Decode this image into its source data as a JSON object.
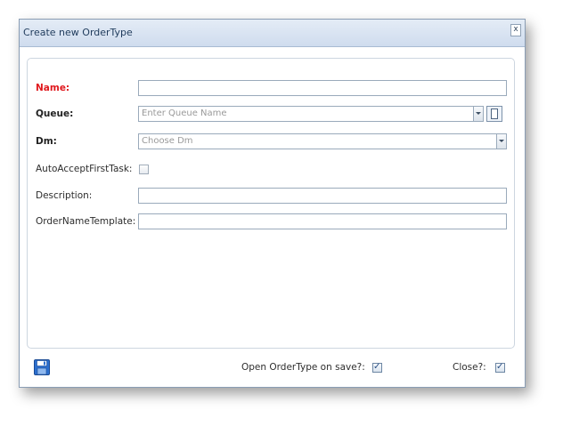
{
  "dialog": {
    "title": "Create new OrderType",
    "close_label": "x"
  },
  "form": {
    "name": {
      "label": "Name:",
      "value": ""
    },
    "queue": {
      "label": "Queue:",
      "placeholder": "Enter Queue Name"
    },
    "dm": {
      "label": "Dm:",
      "placeholder": "Choose Dm"
    },
    "auto_accept": {
      "label": "AutoAcceptFirstTask:",
      "checked": false
    },
    "description": {
      "label": "Description:",
      "value": ""
    },
    "order_name_template": {
      "label": "OrderNameTemplate:",
      "value": ""
    }
  },
  "footer": {
    "save_icon": "floppy-disk-icon",
    "open_on_save": {
      "label": "Open OrderType on save?:",
      "checked": true
    },
    "close": {
      "label": "Close?:",
      "checked": true
    }
  },
  "colors": {
    "required_label": "#e0191e",
    "titlebar": "#d8e3f1",
    "input_border": "#9aaabb"
  }
}
